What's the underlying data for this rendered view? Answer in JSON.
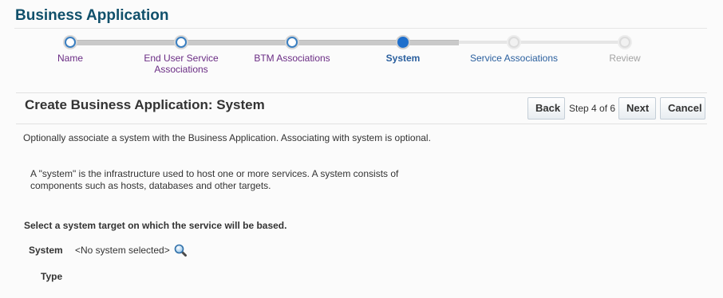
{
  "app": {
    "title": "Business Application"
  },
  "train": {
    "steps": [
      {
        "label": "Name",
        "state": "visited"
      },
      {
        "label": "End User Service Associations",
        "state": "visited"
      },
      {
        "label": "BTM Associations",
        "state": "visited"
      },
      {
        "label": "System",
        "state": "current"
      },
      {
        "label": "Service Associations",
        "state": "next"
      },
      {
        "label": "Review",
        "state": "future"
      }
    ]
  },
  "page": {
    "title": "Create Business Application: System",
    "description": "Optionally associate a system with the Business Application. Associating with system is optional.",
    "info": "A \"system\" is the infrastructure used to host one or more services. A system consists of components such as hosts, databases and other targets."
  },
  "toolbar": {
    "back_label": "Back",
    "step_text": "Step 4 of 6",
    "next_label": "Next",
    "cancel_label": "Cancel"
  },
  "form": {
    "section_heading": "Select a system target on which the service will be based.",
    "system_label": "System",
    "system_value": "<No system selected>",
    "type_label": "Type"
  },
  "colors": {
    "title": "#10506b",
    "visited_step": "#6a2c84",
    "current_step": "#1e6fcc",
    "future_step": "#a3a3a3"
  },
  "icons": {
    "system_search": "search-icon"
  }
}
